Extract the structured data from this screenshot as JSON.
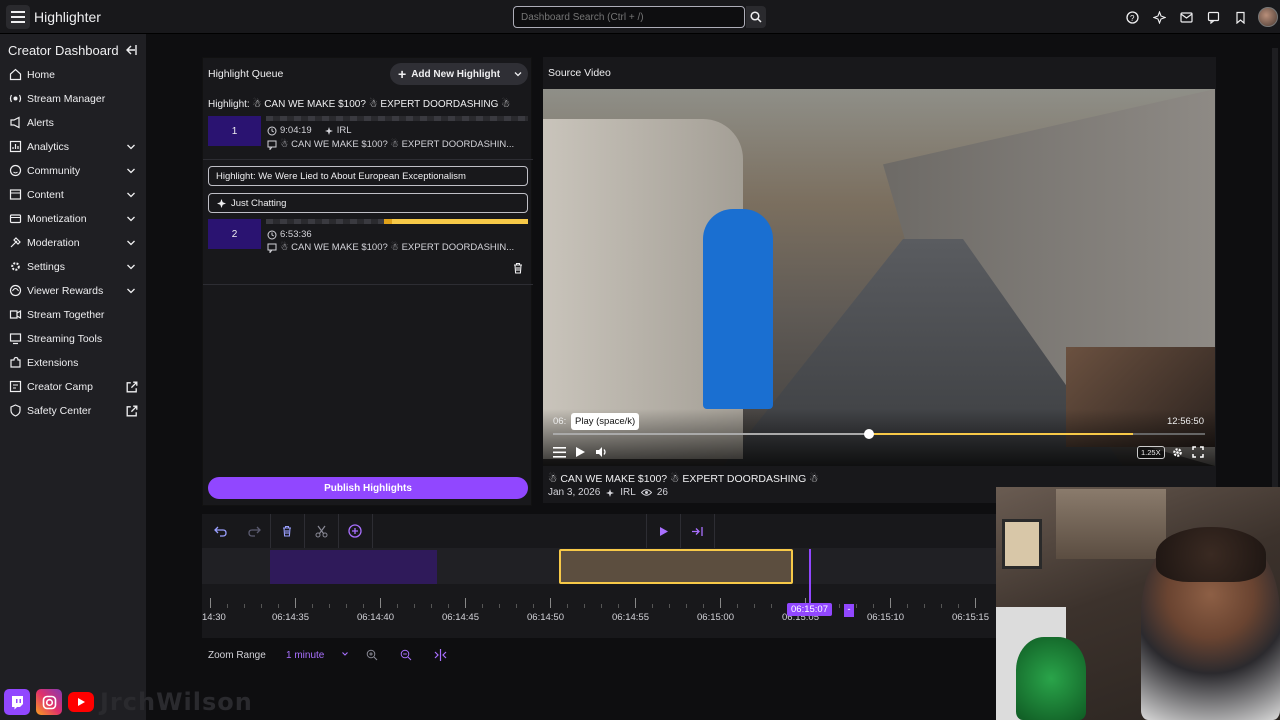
{
  "topbar": {
    "title": "Highlighter",
    "search_placeholder": "Dashboard Search (Ctrl + /)",
    "icons": [
      "help-icon",
      "magic-icon",
      "inbox-icon",
      "whispers-icon",
      "bookmark-icon"
    ]
  },
  "sidebar": {
    "title": "Creator Dashboard",
    "items": [
      {
        "label": "Home",
        "icon": "home-icon",
        "has_chevron": false
      },
      {
        "label": "Stream Manager",
        "icon": "stream-manager-icon",
        "has_chevron": false
      },
      {
        "label": "Alerts",
        "icon": "alerts-icon",
        "has_chevron": false
      },
      {
        "label": "Analytics",
        "icon": "analytics-icon",
        "has_chevron": true
      },
      {
        "label": "Community",
        "icon": "community-icon",
        "has_chevron": true
      },
      {
        "label": "Content",
        "icon": "content-icon",
        "has_chevron": true
      },
      {
        "label": "Monetization",
        "icon": "monetization-icon",
        "has_chevron": true
      },
      {
        "label": "Moderation",
        "icon": "moderation-icon",
        "has_chevron": true
      },
      {
        "label": "Settings",
        "icon": "settings-icon",
        "has_chevron": true
      },
      {
        "label": "Viewer Rewards",
        "icon": "viewer-rewards-icon",
        "has_chevron": true
      },
      {
        "label": "Stream Together",
        "icon": "stream-together-icon",
        "has_chevron": false
      },
      {
        "label": "Streaming Tools",
        "icon": "streaming-tools-icon",
        "has_chevron": false
      },
      {
        "label": "Extensions",
        "icon": "extensions-icon",
        "has_chevron": false
      },
      {
        "label": "Creator Camp",
        "icon": "creator-camp-icon",
        "external": true
      },
      {
        "label": "Safety Center",
        "icon": "safety-center-icon",
        "external": true
      }
    ]
  },
  "queue": {
    "title": "Highlight Queue",
    "add_button": "Add New Highlight",
    "items": [
      {
        "number": "1",
        "title": "Highlight: ☃ CAN WE MAKE $100? ☃ EXPERT DOORDASHING ☃",
        "duration": "9:04:19",
        "category": "IRL",
        "stream_title": "☃ CAN WE MAKE $100? ☃ EXPERT DOORDASHIN..."
      },
      {
        "number": "2",
        "title_field": "Highlight: We Were Lied to About European Exceptionalism",
        "category_field": "Just Chatting",
        "duration": "6:53:36",
        "stream_title": "☃ CAN WE MAKE $100? ☃ EXPERT DOORDASHIN..."
      }
    ],
    "publish_button": "Publish Highlights"
  },
  "source": {
    "title": "Source Video",
    "time_start": "06:",
    "tooltip": "Play (space/k)",
    "time_end": "12:56:50",
    "speed": "1.25X",
    "progress": 0.485,
    "highlight_start": 0.485,
    "highlight_end": 0.89,
    "video_title": "☃ CAN WE MAKE $100? ☃ EXPERT DOORDASHING ☃",
    "date": "Jan 3, 2026",
    "category": "IRL",
    "viewers": "26"
  },
  "timeline": {
    "playhead": "06:15:07",
    "playhead_minus": "-",
    "labels": [
      "14:30",
      "06:14:35",
      "06:14:40",
      "06:14:45",
      "06:14:50",
      "06:14:55",
      "06:15:00",
      "06:15:05",
      "06:15:10",
      "06:15:15"
    ],
    "zoom_label": "Zoom Range",
    "zoom_value": "1 minute"
  },
  "socials": {
    "name": "JrchWilson"
  }
}
